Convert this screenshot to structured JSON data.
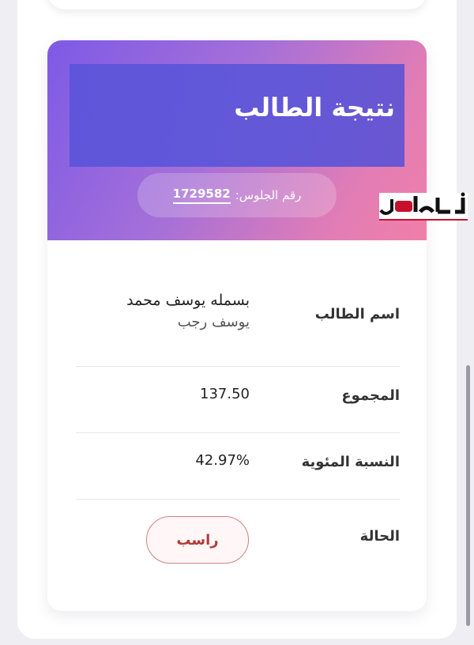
{
  "result": {
    "title": "نتيجة الطالب",
    "seat_label": "رقم الجلوس:",
    "seat_number": "1729582",
    "rows": {
      "name_label": "اسم الطالب",
      "name_line1": "بسمله يوسف محمد",
      "name_line2": "يوسف رجب",
      "total_label": "المجموع",
      "total_value": "137.50",
      "percent_label": "النسبة المئوية",
      "percent_value": "42.97%",
      "status_label": "الحالة",
      "status_value": "راسب"
    }
  },
  "watermark": {
    "text": "أهل مصر"
  },
  "colors": {
    "header_gradient_start": "#7d5ae6",
    "header_gradient_end": "#f07fa8",
    "title_box": "#5f55db",
    "status_fail": "#b43a3a",
    "watermark_red": "#c8102e"
  }
}
